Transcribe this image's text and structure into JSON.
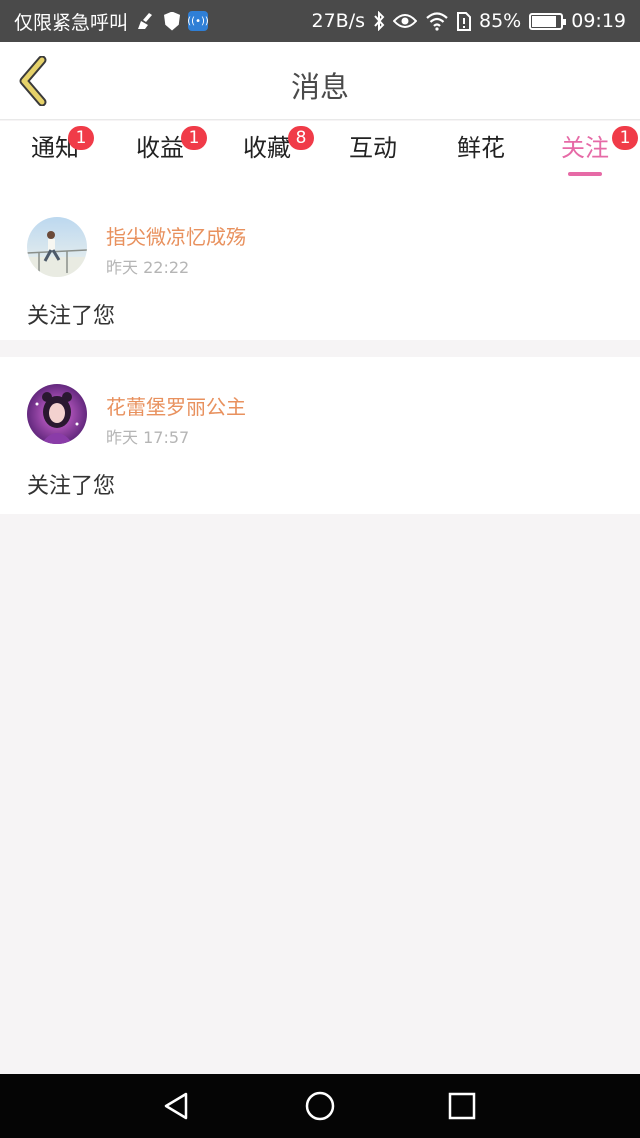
{
  "status_bar": {
    "carrier_text": "仅限紧急呼叫",
    "net_speed": "27B/s",
    "battery_percent": "85%",
    "battery_level": 0.85,
    "time": "09:19",
    "icons": [
      "broom-icon",
      "shield-icon",
      "wifi-hotspot-icon",
      "bluetooth-icon",
      "eye-icon",
      "wifi-icon",
      "sim-icon",
      "battery-icon"
    ]
  },
  "header": {
    "title": "消息",
    "back_icon": "chevron-left-icon"
  },
  "tabs": [
    {
      "label": "通知",
      "badge": "1"
    },
    {
      "label": "收益",
      "badge": "1"
    },
    {
      "label": "收藏",
      "badge": "8"
    },
    {
      "label": "互动",
      "badge": ""
    },
    {
      "label": "鲜花",
      "badge": ""
    },
    {
      "label": "关注",
      "badge": "1",
      "active": true
    }
  ],
  "messages": [
    {
      "user": "指尖微凉忆成殇",
      "time": "昨天 22:22",
      "text": "关注了您"
    },
    {
      "user": "花蕾堡罗丽公主",
      "time": "昨天 17:57",
      "text": "关注了您"
    }
  ],
  "colors": {
    "accent": "#e66aa6",
    "badge": "#f03b48",
    "username": "#e8915e",
    "back_icon": "#e6d26a"
  },
  "nav_bar": {
    "icons": [
      "back-triangle-icon",
      "home-circle-icon",
      "recents-square-icon"
    ]
  }
}
